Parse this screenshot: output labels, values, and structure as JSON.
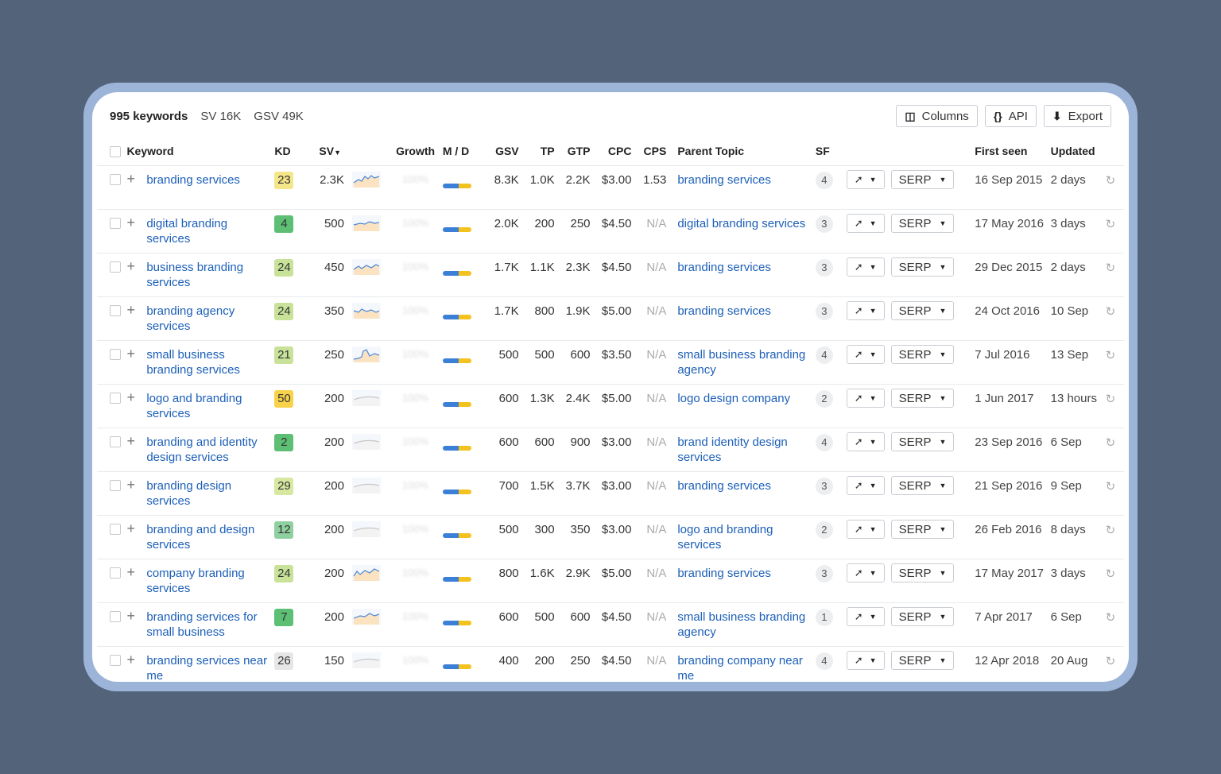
{
  "summary": {
    "keywords": "995 keywords",
    "sv": "SV 16K",
    "gsv": "GSV 49K"
  },
  "toolbar": {
    "columns": "Columns",
    "api": "API",
    "export": "Export"
  },
  "columns": [
    "Keyword",
    "KD",
    "SV",
    "Growth",
    "M / D",
    "GSV",
    "TP",
    "GTP",
    "CPC",
    "CPS",
    "Parent Topic",
    "SF",
    "First seen",
    "Updated"
  ],
  "serp_label": "SERP",
  "rows": [
    {
      "kw": "branding services",
      "kd": "23",
      "kdc": "#f6e68a",
      "sv": "2.3K",
      "gsv": "8.3K",
      "tp": "1.0K",
      "gtp": "2.2K",
      "cpc": "$3.00",
      "cps": "1.53",
      "pt": "branding services",
      "sf": "4",
      "first": "16 Sep 2015",
      "upd": "2 days"
    },
    {
      "kw": "digital branding services",
      "kd": "4",
      "kdc": "#5cbf73",
      "sv": "500",
      "gsv": "2.0K",
      "tp": "200",
      "gtp": "250",
      "cpc": "$4.50",
      "cps": "N/A",
      "pt": "digital branding services",
      "sf": "3",
      "first": "17 May 2016",
      "upd": "3 days"
    },
    {
      "kw": "business branding services",
      "kd": "24",
      "kdc": "#c8e29a",
      "sv": "450",
      "gsv": "1.7K",
      "tp": "1.1K",
      "gtp": "2.3K",
      "cpc": "$4.50",
      "cps": "N/A",
      "pt": "branding services",
      "sf": "3",
      "first": "29 Dec 2015",
      "upd": "2 days"
    },
    {
      "kw": "branding agency services",
      "kd": "24",
      "kdc": "#c8e29a",
      "sv": "350",
      "gsv": "1.7K",
      "tp": "800",
      "gtp": "1.9K",
      "cpc": "$5.00",
      "cps": "N/A",
      "pt": "branding services",
      "sf": "3",
      "first": "24 Oct 2016",
      "upd": "10 Sep"
    },
    {
      "kw": "small business branding services",
      "kd": "21",
      "kdc": "#c8e29a",
      "sv": "250",
      "gsv": "500",
      "tp": "500",
      "gtp": "600",
      "cpc": "$3.50",
      "cps": "N/A",
      "pt": "small business branding agency",
      "sf": "4",
      "first": "7 Jul 2016",
      "upd": "13 Sep"
    },
    {
      "kw": "logo and branding services",
      "kd": "50",
      "kdc": "#f8d24a",
      "sv": "200",
      "gsv": "600",
      "tp": "1.3K",
      "gtp": "2.4K",
      "cpc": "$5.00",
      "cps": "N/A",
      "pt": "logo design company",
      "sf": "2",
      "first": "1 Jun 2017",
      "upd": "13 hours"
    },
    {
      "kw": "branding and identity design services",
      "kd": "2",
      "kdc": "#5cbf73",
      "sv": "200",
      "gsv": "600",
      "tp": "600",
      "gtp": "900",
      "cpc": "$3.00",
      "cps": "N/A",
      "pt": "brand identity design services",
      "sf": "4",
      "first": "23 Sep 2016",
      "upd": "6 Sep"
    },
    {
      "kw": "branding design services",
      "kd": "29",
      "kdc": "#d8e8a0",
      "sv": "200",
      "gsv": "700",
      "tp": "1.5K",
      "gtp": "3.7K",
      "cpc": "$3.00",
      "cps": "N/A",
      "pt": "branding services",
      "sf": "3",
      "first": "21 Sep 2016",
      "upd": "9 Sep"
    },
    {
      "kw": "branding and design services",
      "kd": "12",
      "kdc": "#8fd0a0",
      "sv": "200",
      "gsv": "500",
      "tp": "300",
      "gtp": "350",
      "cpc": "$3.00",
      "cps": "N/A",
      "pt": "logo and branding services",
      "sf": "2",
      "first": "26 Feb 2016",
      "upd": "8 days"
    },
    {
      "kw": "company branding services",
      "kd": "24",
      "kdc": "#c8e29a",
      "sv": "200",
      "gsv": "800",
      "tp": "1.6K",
      "gtp": "2.9K",
      "cpc": "$5.00",
      "cps": "N/A",
      "pt": "branding services",
      "sf": "3",
      "first": "17 May 2017",
      "upd": "3 days"
    },
    {
      "kw": "branding services for small business",
      "kd": "7",
      "kdc": "#5cbf73",
      "sv": "200",
      "gsv": "600",
      "tp": "500",
      "gtp": "600",
      "cpc": "$4.50",
      "cps": "N/A",
      "pt": "small business branding agency",
      "sf": "1",
      "first": "7 Apr 2017",
      "upd": "6 Sep"
    },
    {
      "kw": "branding services near me",
      "kd": "26",
      "kdc": "#e6e6e6",
      "sv": "150",
      "gsv": "400",
      "tp": "200",
      "gtp": "250",
      "cpc": "$4.50",
      "cps": "N/A",
      "pt": "branding company near me",
      "sf": "4",
      "first": "12 Apr 2018",
      "upd": "20 Aug"
    }
  ]
}
